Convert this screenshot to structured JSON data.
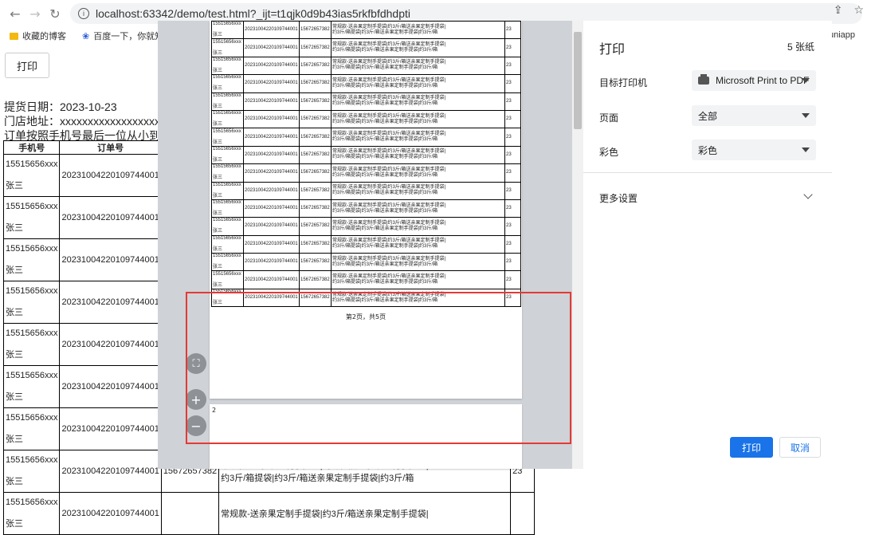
{
  "browser": {
    "url": "localhost:63342/demo/test.html?_ijt=t1qjk0d9b43ias5rkfbfdhdpti",
    "bookmarks": [
      "收藏的博客",
      "百度一下，你就知道"
    ],
    "bookmark_right": "uniapp"
  },
  "page": {
    "print_button": "打印",
    "pickup_date": "提货日期：2023-10-23",
    "store_address": "门店地址：xxxxxxxxxxxxxxxxxx",
    "sort_note": "订单按照手机号最后一位从小到大",
    "headers": [
      "手机号",
      "订单号"
    ],
    "row_phone": "15515656xxx",
    "row_name": "张三",
    "row_order": "20231004220109744001",
    "row_partial": "15",
    "last_row": {
      "phone2": "15672657382",
      "desc_top": "常规款-送亲果定制手提袋|约3斤/箱送亲果定制手提袋|",
      "desc": "约3斤/箱提袋|约3斤/箱送亲果定制手提袋|约3斤/箱",
      "qty": "23",
      "next_desc": "常规款-送亲果定制手提袋|约3斤/箱送亲果定制手提袋|"
    }
  },
  "preview": {
    "row": {
      "phone": "15515656xxx",
      "name": "张三",
      "order": "20231004220109744001",
      "phone2": "15672657382",
      "desc1": "常规款-送亲果定制手提袋|约3斤/箱送亲果定制手提袋|",
      "desc2": "约3斤/箱提袋|约3斤/箱送亲果定制手提袋|约3斤/箱",
      "qty": "23"
    },
    "row_count": 16,
    "footer": "第2页，共5页",
    "page2_number": "2"
  },
  "print_panel": {
    "title": "打印",
    "sheet_count": "5 张纸",
    "destination_label": "目标打印机",
    "destination_value": "Microsoft Print to PDF",
    "pages_label": "页面",
    "pages_value": "全部",
    "color_label": "彩色",
    "color_value": "彩色",
    "more_settings": "更多设置",
    "print_button": "打印",
    "cancel_button": "取消"
  }
}
